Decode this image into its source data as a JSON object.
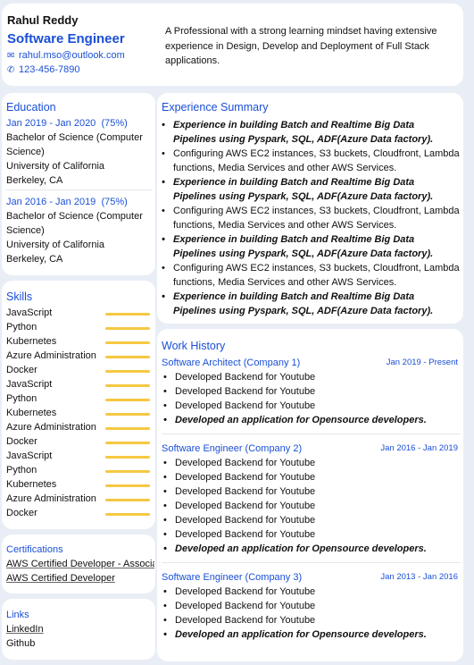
{
  "header": {
    "name": "Rahul Reddy",
    "role": "Software Engineer",
    "email": "rahul.mso@outlook.com",
    "phone": "123-456-7890",
    "summary": "A Professional with a strong learning mindset having extensive experience in Design, Develop and Deployment of Full Stack applications."
  },
  "education": {
    "title": "Education",
    "entries": [
      {
        "dates": "Jan 2019 - Jan 2020",
        "score": "(75%)",
        "degree": "Bachelor of Science (Computer Science)",
        "school": "University of California",
        "location": "Berkeley, CA"
      },
      {
        "dates": "Jan 2016 - Jan 2019",
        "score": "(75%)",
        "degree": "Bachelor of Science (Computer Science)",
        "school": "University of California",
        "location": "Berkeley, CA"
      }
    ]
  },
  "skills": {
    "title": "Skills",
    "items": [
      "JavaScript",
      "Python",
      "Kubernetes",
      "Azure Administration",
      "Docker",
      "JavaScript",
      "Python",
      "Kubernetes",
      "Azure Administration",
      "Docker",
      "JavaScript",
      "Python",
      "Kubernetes",
      "Azure Administration",
      "Docker"
    ],
    "bar_color": "#f6c842"
  },
  "certifications": {
    "title": "Certifications",
    "items": [
      "AWS Certified Developer - Associate",
      "AWS Certified Developer"
    ]
  },
  "links": {
    "title": "Links",
    "items": [
      "LinkedIn",
      "Github"
    ]
  },
  "experience": {
    "title": "Experience Summary",
    "items": [
      {
        "text": "Experience in building Batch and Realtime Big Data Pipelines using Pyspark, SQL, ADF(Azure Data factory).",
        "emphasis": true
      },
      {
        "text": "Configuring AWS EC2 instances, S3 buckets, Cloudfront, Lambda functions, Media Services and other AWS Services.",
        "emphasis": false
      },
      {
        "text": "Experience in building Batch and Realtime Big Data Pipelines using Pyspark, SQL, ADF(Azure Data factory).",
        "emphasis": true
      },
      {
        "text": "Configuring AWS EC2 instances, S3 buckets, Cloudfront, Lambda functions, Media Services and other AWS Services.",
        "emphasis": false
      },
      {
        "text": "Experience in building Batch and Realtime Big Data Pipelines using Pyspark, SQL, ADF(Azure Data factory).",
        "emphasis": true
      },
      {
        "text": "Configuring AWS EC2 instances, S3 buckets, Cloudfront, Lambda functions, Media Services and other AWS Services.",
        "emphasis": false
      },
      {
        "text": "Experience in building Batch and Realtime Big Data Pipelines using Pyspark, SQL, ADF(Azure Data factory).",
        "emphasis": true
      }
    ]
  },
  "work": {
    "title": "Work History",
    "jobs": [
      {
        "title": "Software Architect (Company 1)",
        "dates": "Jan 2019 - Present",
        "bullets": [
          "Developed Backend for Youtube",
          "Developed Backend for Youtube",
          "Developed Backend for Youtube"
        ],
        "highlight": "Developed an application for Opensource developers."
      },
      {
        "title": "Software Engineer (Company 2)",
        "dates": "Jan 2016 - Jan 2019",
        "bullets": [
          "Developed Backend for Youtube",
          "Developed Backend for Youtube",
          "Developed Backend for Youtube",
          "Developed Backend for Youtube",
          "Developed Backend for Youtube",
          "Developed Backend for Youtube"
        ],
        "highlight": "Developed an application for Opensource developers."
      },
      {
        "title": "Software Engineer (Company 3)",
        "dates": "Jan 2013 - Jan 2016",
        "bullets": [
          "Developed Backend for Youtube",
          "Developed Backend for Youtube",
          "Developed Backend for Youtube"
        ],
        "highlight": "Developed an application for Opensource developers."
      }
    ]
  },
  "colors": {
    "accent": "#1a4fd6",
    "background": "#e9eef6",
    "skill_bar": "#f6c842"
  }
}
